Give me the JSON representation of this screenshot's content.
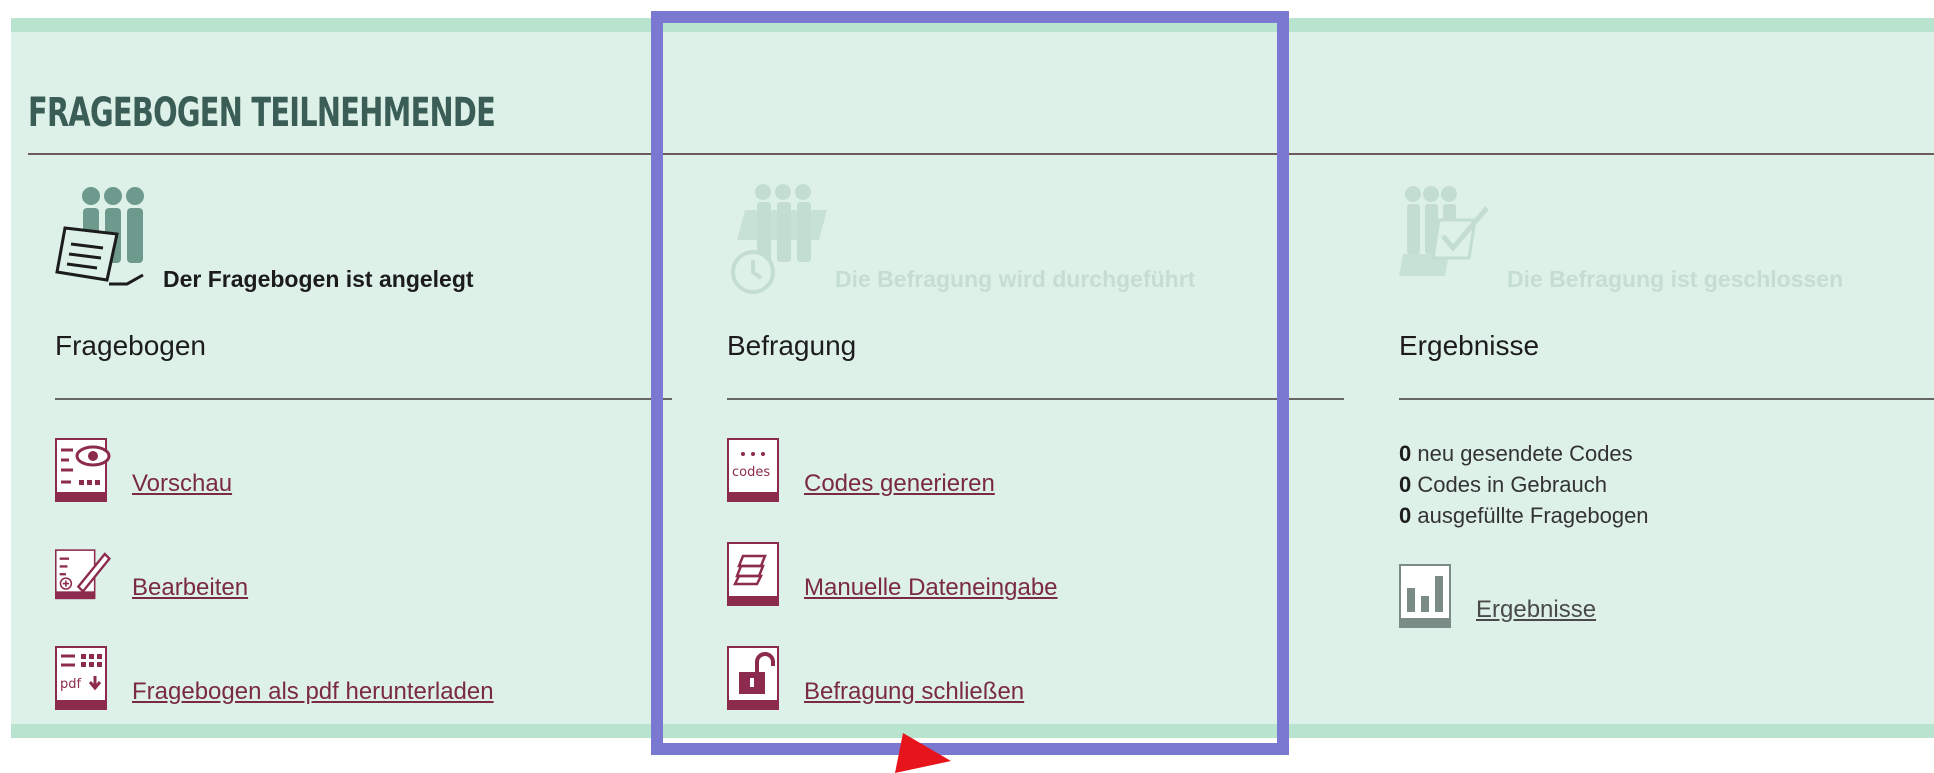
{
  "page": {
    "title": "FRAGEBOGEN TEILNEHMENDE"
  },
  "columns": [
    {
      "status_text": "Der Fragebogen ist angelegt",
      "heading": "Fragebogen",
      "actions": [
        {
          "label": "Vorschau",
          "icon": "preview-icon"
        },
        {
          "label": "Bearbeiten",
          "icon": "edit-icon"
        },
        {
          "label": "Fragebogen als pdf herunterladen",
          "icon": "pdf-download-icon"
        }
      ]
    },
    {
      "status_text": "Die Befragung wird durchgeführt",
      "heading": "Befragung",
      "actions": [
        {
          "label": "Codes generieren",
          "icon": "codes-icon",
          "icon_text": "codes"
        },
        {
          "label": "Manuelle Dateneingabe",
          "icon": "data-entry-icon"
        },
        {
          "label": "Befragung schließen",
          "icon": "unlock-icon"
        }
      ]
    },
    {
      "status_text": "Die Befragung ist geschlossen",
      "heading": "Ergebnisse",
      "stats": [
        {
          "count": "0",
          "label": "neu gesendete Codes"
        },
        {
          "count": "0",
          "label": "Codes in Gebrauch"
        },
        {
          "count": "0",
          "label": "ausgefüllte Fragebogen"
        }
      ],
      "actions": [
        {
          "label": "Ergebnisse",
          "icon": "bar-chart-icon"
        }
      ]
    }
  ],
  "colors": {
    "panel_bg": "#ddf1e8",
    "panel_border": "#b7e3cf",
    "link": "#7a2a42",
    "icon_maroon": "#8c2b4d",
    "highlight": "#7b78d2",
    "pointer": "#e8141b"
  }
}
